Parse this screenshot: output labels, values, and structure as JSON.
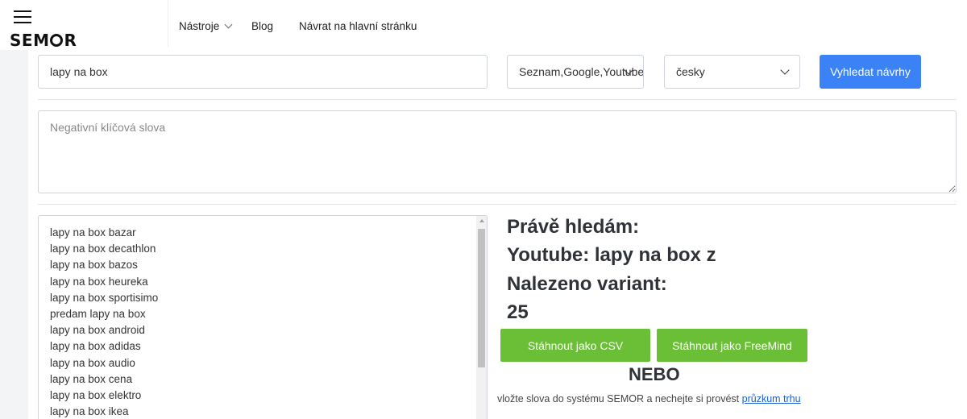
{
  "header": {
    "logo_text": "SEMOR",
    "logo_prefix": "SEM",
    "logo_suffix": "R",
    "nav": {
      "tools": "Nástroje",
      "blog": "Blog",
      "home": "Návrat na hlavní stránku"
    }
  },
  "search": {
    "query": "lapy na box",
    "sources_selected": "Seznam,Google,Youtube",
    "language_selected": "česky",
    "submit_label": "Vyhledat návrhy",
    "negative_placeholder": "Negativní klíčová slova"
  },
  "results": [
    "lapy na box bazar",
    "lapy na box decathlon",
    "lapy na box bazos",
    "lapy na box heureka",
    "lapy na box sportisimo",
    "predam lapy na box",
    "lapy na box android",
    "lapy na box adidas",
    "lapy na box audio",
    "lapy na box cena",
    "lapy na box elektro",
    "lapy na box ikea"
  ],
  "status": {
    "searching_label": "Právě hledám:",
    "current_query": "Youtube: lapy na box z",
    "found_label": "Nalezeno variant:",
    "found_count": "25"
  },
  "actions": {
    "csv_label": "Stáhnout jako CSV",
    "freemind_label": "Stáhnout jako FreeMind",
    "or_label": "NEBO",
    "cta_text": "vložte slova do systému SEMOR a nechejte si provést",
    "cta_link": "průzkum trhu"
  },
  "colors": {
    "primary_button": "#3b82f6",
    "download_button": "#6abf36",
    "link": "#1a5fd0"
  }
}
